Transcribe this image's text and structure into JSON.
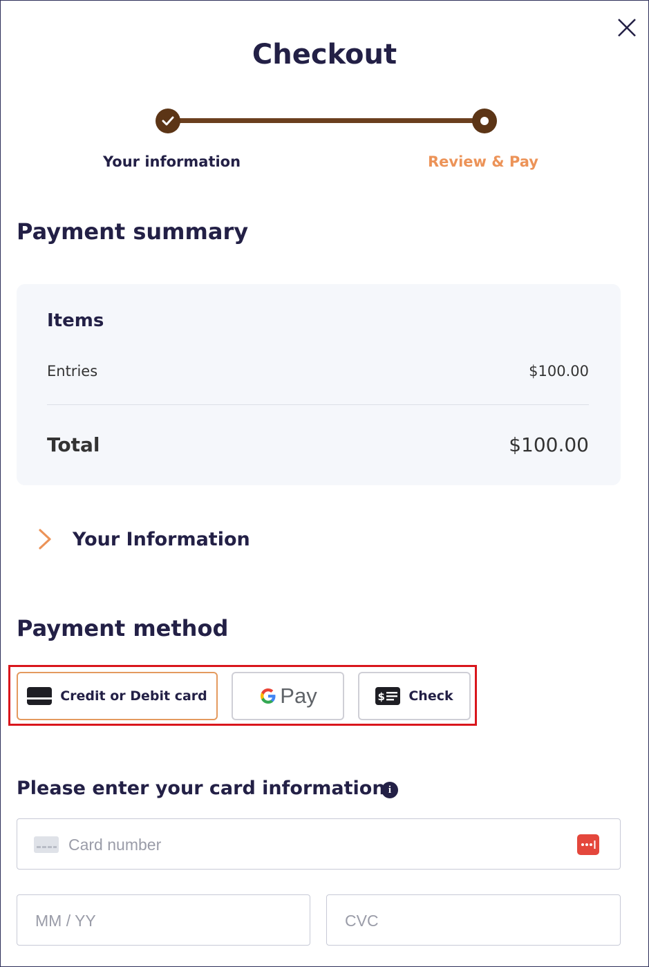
{
  "header": {
    "title": "Checkout",
    "close_icon": "close-icon"
  },
  "stepper": {
    "steps": [
      {
        "label": "Your information",
        "state": "completed"
      },
      {
        "label": "Review & Pay",
        "state": "current"
      }
    ],
    "line_color": "#6b3f1e",
    "active_color": "#ec9358"
  },
  "summary": {
    "heading": "Payment summary",
    "items_title": "Items",
    "rows": [
      {
        "label": "Entries",
        "amount": "$100.00"
      }
    ],
    "total_label": "Total",
    "total_amount": "$100.00"
  },
  "your_info": {
    "label": "Your Information",
    "icon": "chevron-right-icon"
  },
  "payment_method": {
    "heading": "Payment method",
    "options": [
      {
        "label": "Credit or Debit card",
        "icon": "credit-card-icon",
        "selected": true
      },
      {
        "label": "Pay",
        "icon": "google-g-icon",
        "selected": false
      },
      {
        "label": "Check",
        "icon": "check-dollar-icon",
        "selected": false
      }
    ],
    "selected_border_color": "#e49a5e",
    "highlight_color": "#d9161c"
  },
  "card_info": {
    "heading": "Please enter your card information",
    "card_number_placeholder": "Card number",
    "expiry_placeholder": "MM / YY",
    "cvc_placeholder": "CVC"
  }
}
